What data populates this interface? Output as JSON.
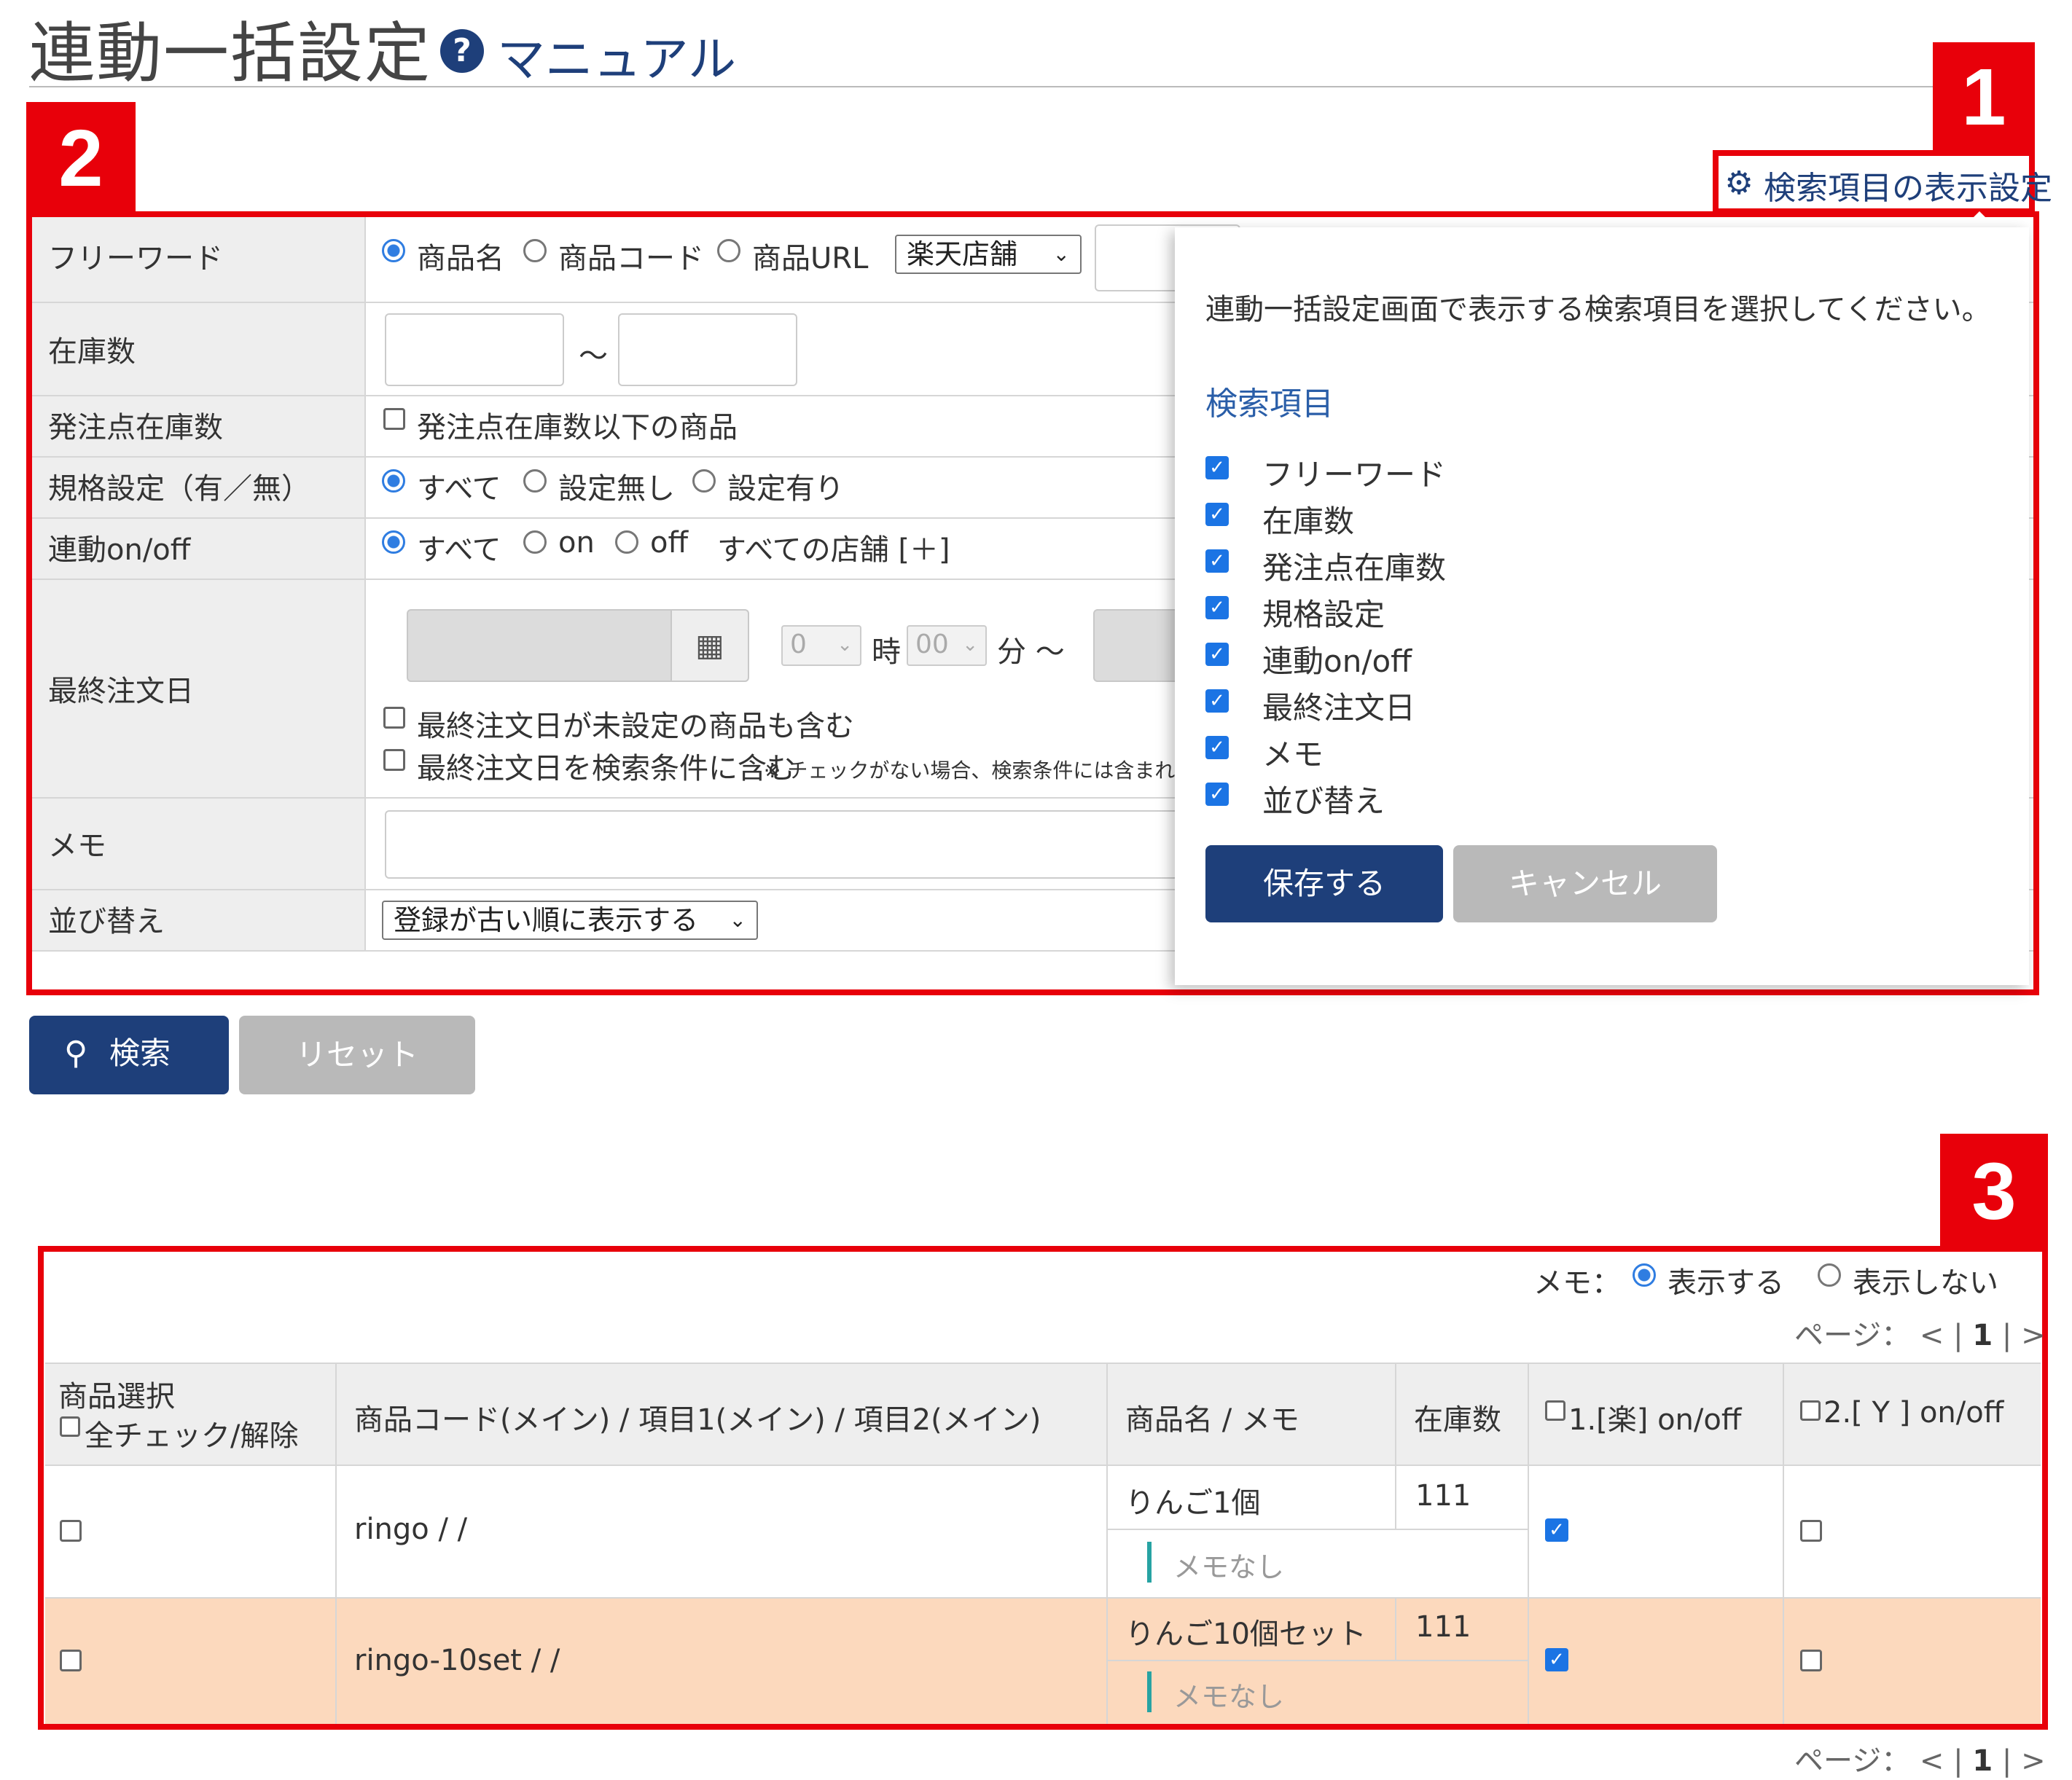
{
  "header": {
    "title": "連動一括設定",
    "manual_icon": "question-circle-icon",
    "manual_label": "マニュアル"
  },
  "badges": {
    "one": "1",
    "two": "2",
    "three": "3"
  },
  "search_settings_link": {
    "icon": "gear-icon",
    "label": "検索項目の表示設定"
  },
  "form": {
    "freeword": {
      "label": "フリーワード",
      "options": [
        "商品名",
        "商品コード",
        "商品URL"
      ],
      "selected": "商品名",
      "store_select": "楽天店舗"
    },
    "stock": {
      "label": "在庫数",
      "separator": "～"
    },
    "reorder": {
      "label": "発注点在庫数",
      "checkbox_label": "発注点在庫数以下の商品"
    },
    "spec": {
      "label": "規格設定（有／無）",
      "options": [
        "すべて",
        "設定無し",
        "設定有り"
      ],
      "selected": "すべて"
    },
    "link": {
      "label": "連動on/off",
      "options": [
        "すべて",
        "on",
        "off"
      ],
      "selected": "すべて",
      "all_stores": "すべての店舗 [＋]"
    },
    "last_order": {
      "label": "最終注文日",
      "calendar_icon": "calendar-icon",
      "hour_value": "0",
      "hour_unit": "時",
      "minute_value": "00",
      "minute_unit": "分 ～",
      "include_unset": "最終注文日が未設定の商品も含む",
      "include_condition": "最終注文日を検索条件に含む",
      "note": "※ チェックがない場合、検索条件には含まれ"
    },
    "memo": {
      "label": "メモ"
    },
    "sort": {
      "label": "並び替え",
      "select_value": "登録が古い順に表示する"
    }
  },
  "popover": {
    "message": "連動一括設定画面で表示する検索項目を選択してください。",
    "section_title": "検索項目",
    "items": [
      "フリーワード",
      "在庫数",
      "発注点在庫数",
      "規格設定",
      "連動on/off",
      "最終注文日",
      "メモ",
      "並び替え"
    ],
    "save": "保存する",
    "cancel": "キャンセル"
  },
  "actions": {
    "search_icon": "search-icon",
    "search": "検索",
    "reset": "リセット"
  },
  "results": {
    "memo_label": "メモ：",
    "memo_show": "表示する",
    "memo_hide": "表示しない",
    "pager": {
      "label": "ページ：",
      "prev": "<",
      "sep": "|",
      "current": "1",
      "next": ">"
    },
    "headers": {
      "select_line1": "商品選択",
      "select_line2": "全チェック/解除",
      "code": "商品コード(メイン) / 項目1(メイン) / 項目2(メイン)",
      "name": "商品名 / メモ",
      "stock": "在庫数",
      "store1": "1.[楽] on/off",
      "store2": "2.[ Y ] on/off"
    },
    "rows": [
      {
        "code": "ringo / /",
        "name": "りんご1個",
        "stock": "111",
        "memo": "メモなし",
        "store1_on": true,
        "store2_on": false
      },
      {
        "code": "ringo-10set / /",
        "name": "りんご10個セット",
        "stock": "111",
        "memo": "メモなし",
        "store1_on": true,
        "store2_on": false
      }
    ]
  },
  "colors": {
    "brand": "#1e3f7a",
    "accent_red": "#e8000a",
    "highlight_row": "#fcd9bd",
    "memo_bar": "#27a3a3"
  }
}
